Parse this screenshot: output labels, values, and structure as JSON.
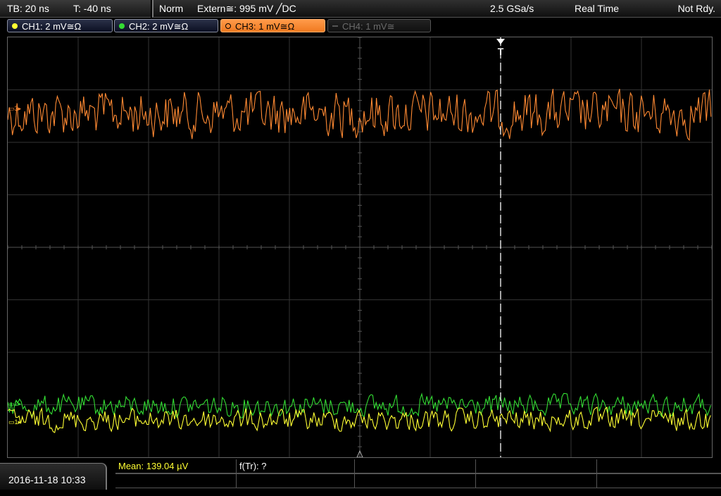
{
  "status": {
    "timebase": "TB: 20 ns",
    "trigger_time": "T: -40 ns",
    "acq_mode": "Norm",
    "trigger_source": "Extern≅: 995 mV ╱DC",
    "sample_rate": "2.5 GSa/s",
    "sampling_mode": "Real Time",
    "state": "Not Rdy."
  },
  "channels": [
    {
      "label": "CH1: 2 mV≅Ω",
      "color": "#ffff33",
      "active": false,
      "enabled": true,
      "ref_tag": "▭1▸"
    },
    {
      "label": "CH2: 2 mV≅Ω",
      "color": "#33dd33",
      "active": false,
      "enabled": true,
      "ref_tag": "▭2▸"
    },
    {
      "label": "CH3: 1 mV≅Ω",
      "color": "#ff8a33",
      "active": true,
      "enabled": true,
      "ref_tag": "▭3▸"
    },
    {
      "label": "CH4: 1 mV≅",
      "color": "#666666",
      "active": false,
      "enabled": false
    }
  ],
  "trigger_marker": "T",
  "bottom": {
    "datetime": "2016-11-18 10:33",
    "measurement_1": "Mean: 139.04 µV",
    "measurement_2": "f(Tr): ?"
  }
}
